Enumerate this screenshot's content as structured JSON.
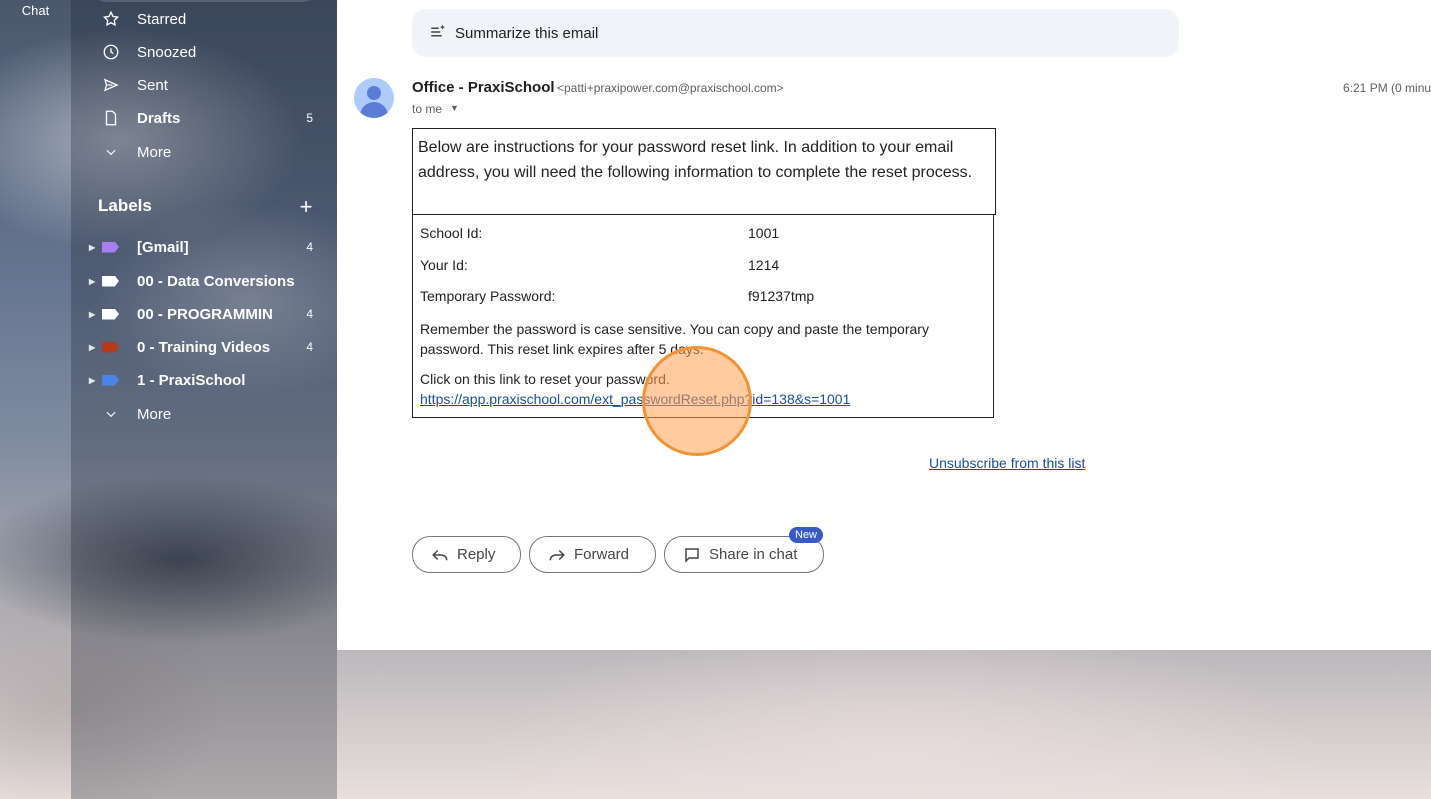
{
  "left_rail": {
    "chat_label": "Chat"
  },
  "sidebar": {
    "nav": [
      {
        "label": "Starred",
        "icon": "star-icon"
      },
      {
        "label": "Snoozed",
        "icon": "clock-icon"
      },
      {
        "label": "Sent",
        "icon": "send-icon"
      },
      {
        "label": "Drafts",
        "icon": "draft-icon",
        "count": "5"
      },
      {
        "label": "More",
        "icon": "chevron-down-icon"
      }
    ],
    "labels_heading": "Labels",
    "labels_add": "+",
    "labels": [
      {
        "label": "[Gmail]",
        "count": "4",
        "color": "#a87ef5"
      },
      {
        "label": "00 - Data Conversions",
        "count": "",
        "color": "#ffffff"
      },
      {
        "label": "00 - PROGRAMMIN",
        "count": "4",
        "color": "#ffffff"
      },
      {
        "label": "0 - Training Videos",
        "count": "4",
        "color": "#b5391b"
      },
      {
        "label": "1 - PraxiSchool",
        "count": "",
        "color": "#4a86e8"
      }
    ],
    "labels_more": "More"
  },
  "email": {
    "summarize_label": "Summarize this email",
    "sender_name": "Office - PraxiSchool",
    "sender_email": "<patti+praxipower.com@praxischool.com>",
    "time": "6:21 PM (0 minu",
    "to": "to me",
    "intro": "Below are instructions for your password reset link. In addition to your email address, you will need the following information to complete the reset process.",
    "fields": [
      {
        "label": "School Id:",
        "value": "1001"
      },
      {
        "label": "Your Id:",
        "value": "1214"
      },
      {
        "label": "Temporary Password:",
        "value": "f91237tmp"
      }
    ],
    "remember": "Remember the password is case sensitive. You can copy and paste the temporary password. This reset link expires after 5 days.",
    "click_text": "Click on this link to reset your password.",
    "reset_link": "https://app.praxischool.com/ext_passwordReset.php?id=138&s=1001",
    "unsubscribe": "Unsubscribe from this list"
  },
  "actions": {
    "reply": "Reply",
    "forward": "Forward",
    "share": "Share in chat",
    "new_badge": "New"
  },
  "colors": {
    "accent": "#3859c8",
    "link": "#1a4fa0",
    "marker": "#f39336"
  }
}
